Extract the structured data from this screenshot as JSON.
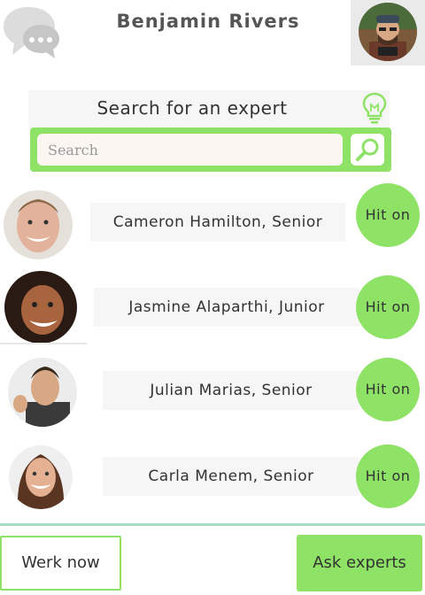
{
  "header": {
    "title": "Benjamin Rivers",
    "chat_icon": "chat-bubbles-icon",
    "profile_avatar": "user-avatar"
  },
  "search": {
    "banner_text": "Search for an expert",
    "banner_icon": "lightbulb-icon",
    "placeholder": "Search",
    "button_icon": "magnifier-icon"
  },
  "experts": [
    {
      "name": "Cameron Hamilton, Senior",
      "action": "Hit on"
    },
    {
      "name": "Jasmine Alaparthi, Junior",
      "action": "Hit on"
    },
    {
      "name": "Julian Marias, Senior",
      "action": "Hit on"
    },
    {
      "name": "Carla Menem, Senior",
      "action": "Hit on"
    }
  ],
  "footer": {
    "werk_now": "Werk now",
    "ask_experts": "Ask experts"
  },
  "colors": {
    "accent_green": "#8ee266",
    "panel_gray": "#f6f6f6",
    "divider_teal": "#a8dfc4"
  }
}
